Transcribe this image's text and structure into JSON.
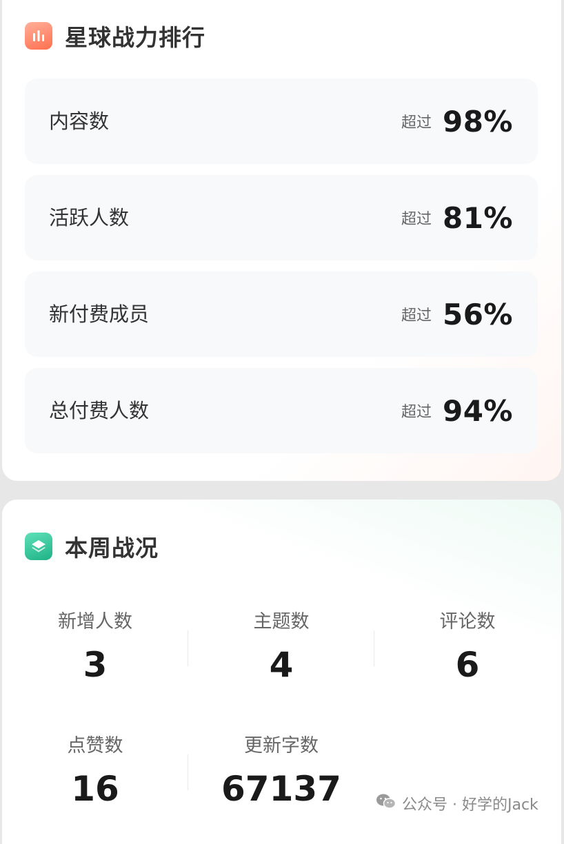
{
  "ranking": {
    "title": "星球战力排行",
    "icon": "bar-chart-icon",
    "rows": [
      {
        "label": "内容数",
        "prefix": "超过",
        "value": "98%"
      },
      {
        "label": "活跃人数",
        "prefix": "超过",
        "value": "81%"
      },
      {
        "label": "新付费成员",
        "prefix": "超过",
        "value": "56%"
      },
      {
        "label": "总付费人数",
        "prefix": "超过",
        "value": "94%"
      }
    ]
  },
  "weekly": {
    "title": "本周战况",
    "icon": "layers-icon",
    "stats": [
      {
        "label": "新增人数",
        "value": "3"
      },
      {
        "label": "主题数",
        "value": "4"
      },
      {
        "label": "评论数",
        "value": "6"
      },
      {
        "label": "点赞数",
        "value": "16"
      },
      {
        "label": "更新字数",
        "value": "67137"
      }
    ]
  },
  "watermark": {
    "text": "公众号 · 好学的Jack",
    "icon": "wechat-icon"
  },
  "colors": {
    "orange_accent": "#ff6f4f",
    "green_accent": "#1fb286",
    "row_bg": "#f8f9fb"
  }
}
